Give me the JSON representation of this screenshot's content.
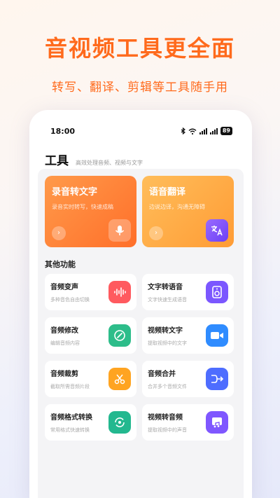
{
  "headline": "音视频工具更全面",
  "subline": "转写、翻译、剪辑等工具随手用",
  "status": {
    "time": "18:00",
    "battery": "89"
  },
  "header": {
    "title": "工具",
    "subtitle": "高效处理音频、视频与文字"
  },
  "features": [
    {
      "title": "录音转文字",
      "desc": "录音实时转写，快速成稿",
      "arrow": "›",
      "icon": "mic-icon",
      "color": "#ff7a2e"
    },
    {
      "title": "语音翻译",
      "desc": "边说边译，沟通无障碍",
      "arrow": "›",
      "icon": "translate-icon",
      "color": "#7a4dff"
    }
  ],
  "section_title": "其他功能",
  "tools": [
    {
      "name": "音频变声",
      "desc": "多种音色自由切换",
      "icon": "waveform-icon",
      "color": "#ff5a5f"
    },
    {
      "name": "文字转语音",
      "desc": "文字快速生成语音",
      "icon": "speaker-icon",
      "color": "#7b57ff"
    },
    {
      "name": "音频修改",
      "desc": "编辑音频内容",
      "icon": "edit-icon",
      "color": "#2dbd8a"
    },
    {
      "name": "视频转文字",
      "desc": "提取视频中的文字",
      "icon": "video-icon",
      "color": "#2f8cff"
    },
    {
      "name": "音频裁剪",
      "desc": "截取所需音频片段",
      "icon": "scissors-icon",
      "color": "#ffa421"
    },
    {
      "name": "音频合并",
      "desc": "合并多个音频文件",
      "icon": "merge-icon",
      "color": "#4e6dff"
    },
    {
      "name": "音频格式转换",
      "desc": "常用格式快速转换",
      "icon": "convert-icon",
      "color": "#23b88f"
    },
    {
      "name": "视频转音频",
      "desc": "提取视频中的声音",
      "icon": "video-audio-icon",
      "color": "#7f57ff"
    }
  ]
}
